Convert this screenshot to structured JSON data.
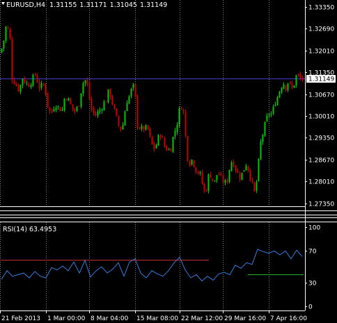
{
  "chart_data": [
    {
      "type": "candlestick",
      "title": "EURUSD,H4",
      "header_values": [
        "1.31155",
        "1.31171",
        "1.31045",
        "1.31149"
      ],
      "y_ticks": [
        "1.33350",
        "1.32690",
        "1.32010",
        "1.31350",
        "1.30670",
        "1.30010",
        "1.29350",
        "1.28670",
        "1.28010",
        "1.27350"
      ],
      "ylim": [
        1.2715,
        1.3345
      ],
      "current_price_label": "1.31149",
      "current_price": 1.31149,
      "x_ticks": [
        "21 Feb 2013",
        "1 Mar 00:00",
        "8 Mar 04:00",
        "15 Mar 08:00",
        "22 Mar 12:00",
        "29 Mar 16:00",
        "7 Apr 16:00"
      ],
      "up_color": "#00c800",
      "down_color": "#c80000",
      "price_line_color": "#3d3dcc",
      "grid": "dotted",
      "close_path": [
        [
          0,
          1.3195
        ],
        [
          4,
          1.322
        ],
        [
          9,
          1.3285
        ],
        [
          14,
          1.3235
        ],
        [
          17,
          1.3118
        ],
        [
          22,
          1.31
        ],
        [
          27,
          1.308
        ],
        [
          32,
          1.3118
        ],
        [
          37,
          1.31
        ],
        [
          42,
          1.3098
        ],
        [
          50,
          1.3128
        ],
        [
          56,
          1.309
        ],
        [
          62,
          1.3095
        ],
        [
          66,
          1.307
        ],
        [
          69,
          1.3015
        ],
        [
          74,
          1.3015
        ],
        [
          79,
          1.304
        ],
        [
          84,
          1.3025
        ],
        [
          89,
          1.302
        ],
        [
          93,
          1.3065
        ],
        [
          98,
          1.305
        ],
        [
          103,
          1.3025
        ],
        [
          108,
          1.3015
        ],
        [
          113,
          1.304
        ],
        [
          117,
          1.309
        ],
        [
          121,
          1.3115
        ],
        [
          126,
          1.309
        ],
        [
          129,
          1.3035
        ],
        [
          133,
          1.301
        ],
        [
          137,
          1.3005
        ],
        [
          142,
          1.3015
        ],
        [
          147,
          1.3035
        ],
        [
          152,
          1.305
        ],
        [
          156,
          1.308
        ],
        [
          160,
          1.305
        ],
        [
          163,
          1.3025
        ],
        [
          168,
          1.2985
        ],
        [
          172,
          1.296
        ],
        [
          176,
          1.2975
        ],
        [
          181,
          1.3045
        ],
        [
          186,
          1.3065
        ],
        [
          190,
          1.3095
        ],
        [
          193,
          1.308
        ],
        [
          197,
          1.2975
        ],
        [
          202,
          1.296
        ],
        [
          207,
          1.2965
        ],
        [
          212,
          1.296
        ],
        [
          217,
          1.2915
        ],
        [
          222,
          1.29
        ],
        [
          227,
          1.2935
        ],
        [
          231,
          1.295
        ],
        [
          235,
          1.291
        ],
        [
          240,
          1.29
        ],
        [
          244,
          1.2895
        ],
        [
          248,
          1.2935
        ],
        [
          252,
          1.2965
        ],
        [
          255,
          1.299
        ],
        [
          258,
          1.303
        ],
        [
          262,
          1.3035
        ],
        [
          265,
          1.297
        ],
        [
          268,
          1.288
        ],
        [
          272,
          1.286
        ],
        [
          276,
          1.287
        ],
        [
          280,
          1.284
        ],
        [
          284,
          1.283
        ],
        [
          288,
          1.282
        ],
        [
          292,
          1.277
        ],
        [
          296,
          1.278
        ],
        [
          300,
          1.283
        ],
        [
          304,
          1.281
        ],
        [
          308,
          1.28
        ],
        [
          312,
          1.283
        ],
        [
          317,
          1.281
        ],
        [
          321,
          1.28
        ],
        [
          325,
          1.2795
        ],
        [
          329,
          1.284
        ],
        [
          333,
          1.287
        ],
        [
          337,
          1.2845
        ],
        [
          341,
          1.2825
        ],
        [
          345,
          1.2815
        ],
        [
          349,
          1.2835
        ],
        [
          353,
          1.2855
        ],
        [
          357,
          1.2835
        ],
        [
          361,
          1.28
        ],
        [
          366,
          1.276
        ],
        [
          370,
          1.284
        ],
        [
          374,
          1.292
        ],
        [
          378,
          1.2955
        ],
        [
          382,
          1.299
        ],
        [
          386,
          1.301
        ],
        [
          390,
          1.3005
        ],
        [
          394,
          1.304
        ],
        [
          398,
          1.306
        ],
        [
          402,
          1.3085
        ],
        [
          406,
          1.3105
        ],
        [
          410,
          1.309
        ],
        [
          414,
          1.311
        ],
        [
          418,
          1.308
        ],
        [
          422,
          1.31
        ],
        [
          426,
          1.313
        ],
        [
          430,
          1.3115
        ],
        [
          434,
          1.3114
        ]
      ]
    },
    {
      "type": "line",
      "title": "RSI(14) 63.4953",
      "y_ticks": [
        "100",
        "70",
        "30",
        "0"
      ],
      "ylim": [
        0,
        100
      ],
      "levels": [
        {
          "value": 59,
          "color": "#c03030"
        },
        {
          "value": 40,
          "color": "#22b522"
        }
      ],
      "line_color": "#2f7fe0",
      "x": [
        2,
        10,
        18,
        26,
        34,
        42,
        50,
        58,
        66,
        74,
        82,
        90,
        98,
        106,
        114,
        122,
        130,
        138,
        146,
        154,
        162,
        170,
        178,
        186,
        194,
        202,
        210,
        218,
        226,
        234,
        242,
        250,
        258,
        266,
        274,
        282,
        290,
        298,
        306,
        314,
        322,
        330,
        338,
        346,
        354,
        362,
        370,
        378,
        386,
        394,
        402,
        410,
        418,
        426,
        434
      ],
      "values": [
        34,
        45,
        38,
        40,
        42,
        36,
        44,
        38,
        36,
        49,
        46,
        51,
        45,
        56,
        42,
        58,
        37,
        45,
        50,
        42,
        47,
        55,
        38,
        56,
        60,
        42,
        36,
        45,
        41,
        38,
        45,
        55,
        62,
        46,
        36,
        40,
        32,
        38,
        33,
        41,
        43,
        40,
        52,
        48,
        55,
        53,
        72,
        69,
        67,
        70,
        65,
        70,
        60,
        71,
        63
      ]
    }
  ]
}
